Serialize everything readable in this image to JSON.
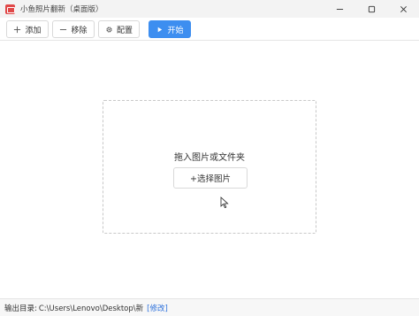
{
  "window": {
    "title": "小鱼照片翻新（桌面版）",
    "app_icon": "photo-app-icon",
    "controls": {
      "minimize_icon": "minimize-icon",
      "maximize_icon": "maximize-icon",
      "close_icon": "close-icon"
    }
  },
  "toolbar": {
    "add_label": "添加",
    "remove_label": "移除",
    "config_label": "配置",
    "start_label": "开始",
    "add_icon": "plus-icon",
    "remove_icon": "minus-icon",
    "config_icon": "gear-icon",
    "start_icon": "play-icon",
    "accent_color": "#3d8ef0"
  },
  "dropzone": {
    "hint": "拖入图片或文件夹",
    "select_label": "+选择图片"
  },
  "status": {
    "output_label": "输出目录:",
    "output_path": "C:\\Users\\Lenovo\\Desktop\\新",
    "edit_label": "[修改]"
  }
}
